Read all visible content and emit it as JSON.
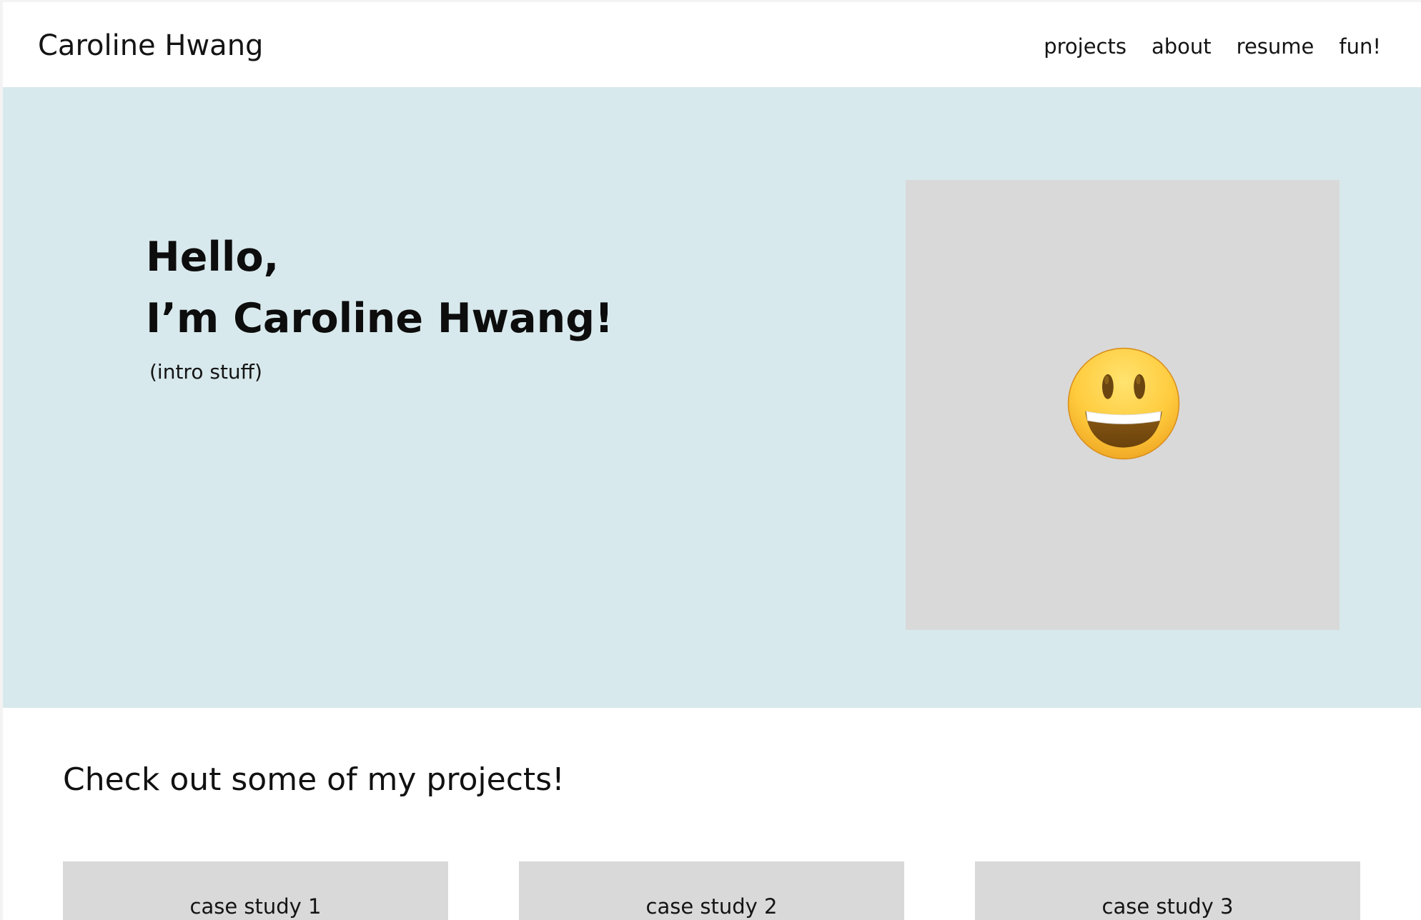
{
  "header": {
    "site_name": "Caroline Hwang",
    "nav": [
      "projects",
      "about",
      "resume",
      "fun!"
    ]
  },
  "hero": {
    "greeting": "Hello,",
    "name_line": "I’m Caroline Hwang!",
    "intro": "(intro stuff)",
    "photo_icon": "smiley-face-emoji",
    "background_color": "#d8e9ed",
    "photo_placeholder_color": "#d9d9d9"
  },
  "projects": {
    "heading": "Check out some of my projects!",
    "cards": [
      "case study 1",
      "case study 2",
      "case study 3"
    ]
  }
}
